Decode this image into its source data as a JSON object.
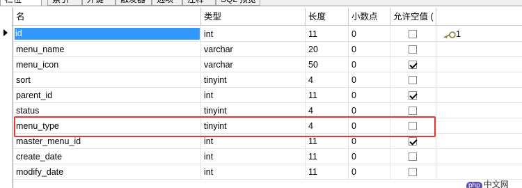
{
  "tabs": [
    {
      "label": "栏位",
      "active": true
    },
    {
      "label": "索引",
      "active": false
    },
    {
      "label": "外键",
      "active": false
    },
    {
      "label": "触发器",
      "active": false
    },
    {
      "label": "选项",
      "active": false
    },
    {
      "label": "注释",
      "active": false
    },
    {
      "label": "SQL 预览",
      "active": false
    }
  ],
  "columns": {
    "name": "名",
    "type": "类型",
    "length": "长度",
    "decimals": "小数点",
    "nullable": "允许空值 ("
  },
  "rows": [
    {
      "name": "id",
      "type": "int",
      "length": "11",
      "decimals": "0",
      "nullable": false,
      "key": "1",
      "selected": true
    },
    {
      "name": "menu_name",
      "type": "varchar",
      "length": "20",
      "decimals": "0",
      "nullable": false
    },
    {
      "name": "menu_icon",
      "type": "varchar",
      "length": "50",
      "decimals": "0",
      "nullable": true
    },
    {
      "name": "sort",
      "type": "tinyint",
      "length": "4",
      "decimals": "0",
      "nullable": false
    },
    {
      "name": "parent_id",
      "type": "int",
      "length": "11",
      "decimals": "0",
      "nullable": true
    },
    {
      "name": "status",
      "type": "tinyint",
      "length": "4",
      "decimals": "0",
      "nullable": false
    },
    {
      "name": "menu_type",
      "type": "tinyint",
      "length": "4",
      "decimals": "0",
      "nullable": false,
      "highlighted": true
    },
    {
      "name": "master_menu_id",
      "type": "int",
      "length": "11",
      "decimals": "0",
      "nullable": true
    },
    {
      "name": "create_date",
      "type": "int",
      "length": "11",
      "decimals": "0",
      "nullable": false
    },
    {
      "name": "modify_date",
      "type": "int",
      "length": "11",
      "decimals": "0",
      "nullable": false
    }
  ],
  "watermark": {
    "badge": "php",
    "text": "中文网"
  },
  "colors": {
    "selection": "#3399ff",
    "highlight_box": "#e53935",
    "grid_line": "#e3e3e3"
  },
  "icons": {
    "key": "key-icon",
    "row_pointer": "row-pointer-icon"
  }
}
